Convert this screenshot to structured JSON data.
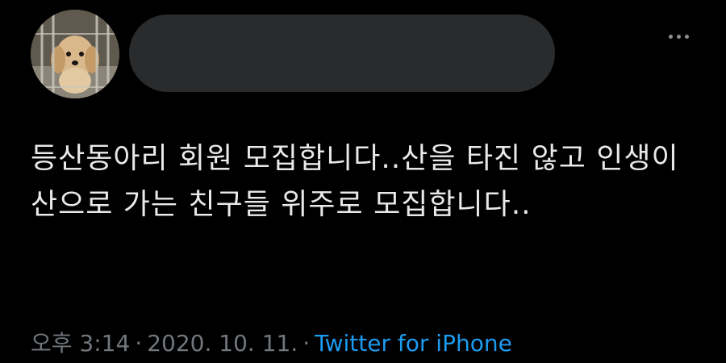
{
  "tweet": {
    "text": "등산동아리 회원 모집합니다..산을 타진 않고 인생이 산으로 가는 친구들 위주로 모집합니다..",
    "time": "오후 3:14",
    "date": "2020. 10. 11.",
    "separator": "·",
    "source": "Twitter for iPhone"
  },
  "icons": {
    "avatar": "puppy-avatar",
    "more": "more-options-icon"
  },
  "colors": {
    "background": "#000000",
    "text": "#e7e9ea",
    "meta": "#71767b",
    "link": "#1d9bf0",
    "redaction": "#2a2b2c"
  }
}
